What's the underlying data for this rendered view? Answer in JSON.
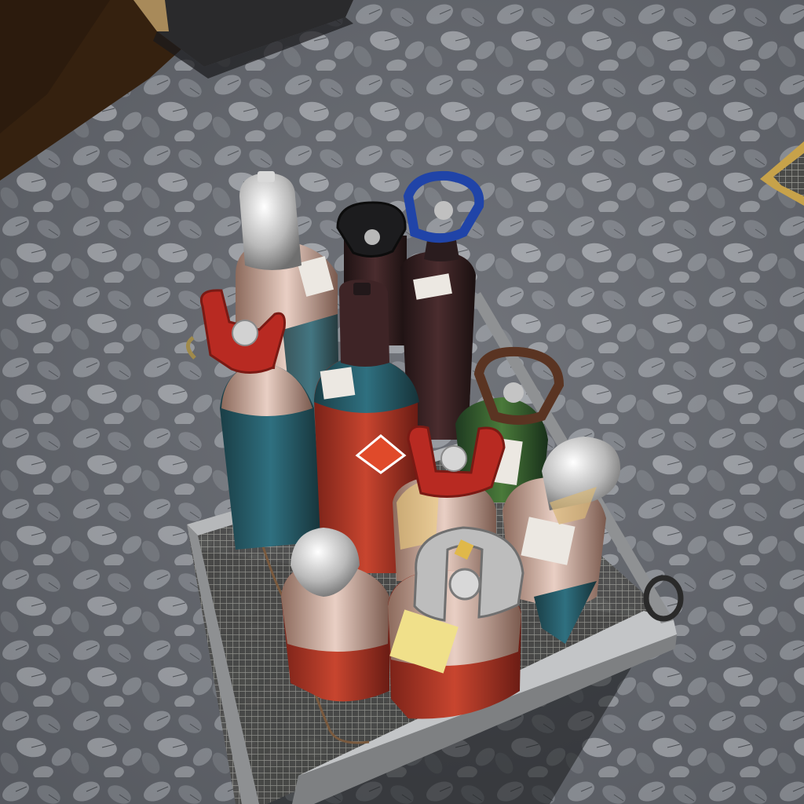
{
  "scene": {
    "description_hidden": "",
    "colors": {
      "ground": "#6e7178",
      "ground_dark": "#3c3f45",
      "leaf_light": "#b8bcc2",
      "dirt": "#3a2416",
      "cart_frame": "#9a9c9e",
      "mesh": "#6a6a66",
      "cylinder_red": "#c0402e",
      "cylinder_teal": "#2c6a78",
      "cylinder_maroon": "#3a2426",
      "cylinder_green": "#2f5a30",
      "cap_silver": "#c9c9c9",
      "guard_red": "#b82a22",
      "guard_blue": "#2044a8",
      "guard_black": "#1c1c1e",
      "guard_brown": "#5a3422",
      "guard_grey": "#bdbdbd",
      "label_yellow": "#f0e08a",
      "label_white": "#ece8e2"
    }
  }
}
